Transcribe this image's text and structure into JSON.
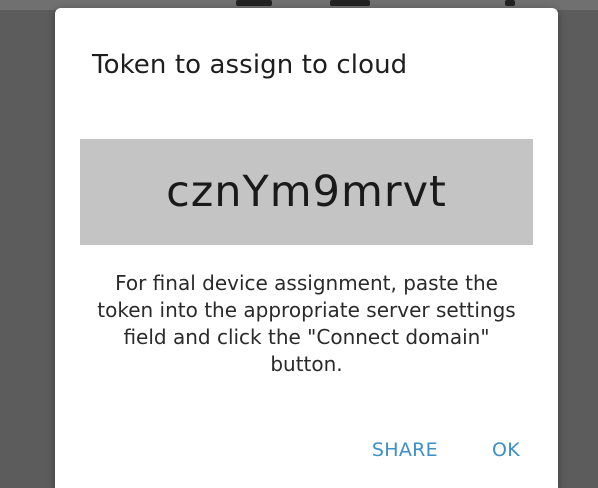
{
  "dialog": {
    "title": "Token to assign to cloud",
    "token": "cznYm9mrvt",
    "message": "For final device assignment, paste the token into the appropriate server settings field and click the \"Connect domain\" button.",
    "actions": {
      "share_label": "SHARE",
      "ok_label": "OK"
    }
  },
  "colors": {
    "scrim": "#5c5c5c",
    "dialog_background": "#ffffff",
    "token_background": "#c4c4c4",
    "accent": "#3d8fc9"
  }
}
